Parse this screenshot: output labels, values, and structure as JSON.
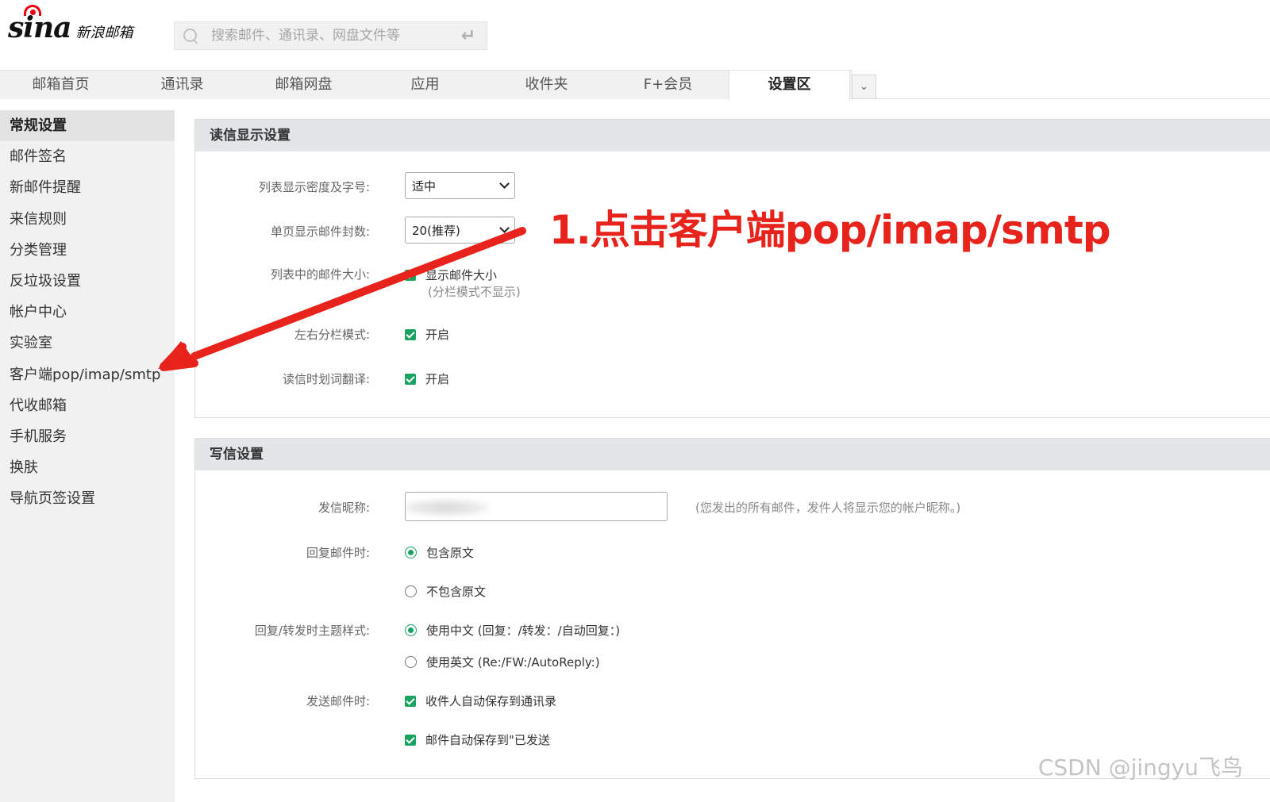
{
  "header": {
    "logo_mark": "sina",
    "logo_text": "新浪邮箱",
    "search_placeholder": "搜索邮件、通讯录、网盘文件等",
    "enter_glyph": "↵"
  },
  "nav": {
    "items": [
      "邮箱首页",
      "通讯录",
      "邮箱网盘",
      "应用",
      "收件夹",
      "F+会员",
      "设置区"
    ],
    "active_index": 6,
    "more_glyph": "⌄"
  },
  "sidebar": {
    "items": [
      "常规设置",
      "邮件签名",
      "新邮件提醒",
      "来信规则",
      "分类管理",
      "反垃圾设置",
      "帐户中心",
      "实验室",
      "客户端pop/imap/smtp",
      "代收邮箱",
      "手机服务",
      "换肤",
      "导航页签设置"
    ],
    "active_index": 0
  },
  "read_panel": {
    "title": "读信显示设置",
    "density_label": "列表显示密度及字号:",
    "density_value": "适中",
    "per_page_label": "单页显示邮件封数:",
    "per_page_value": "20(推荐)",
    "size_label": "列表中的邮件大小:",
    "size_option": "显示邮件大小",
    "size_note": "(分栏模式不显示)",
    "split_label": "左右分栏模式:",
    "split_option": "开启",
    "translate_label": "读信时划词翻译:",
    "translate_option": "开启"
  },
  "write_panel": {
    "title": "写信设置",
    "nick_label": "发信昵称:",
    "nick_hint": "(您发出的所有邮件，发件人将显示您的帐户昵称。)",
    "reply_label": "回复邮件时:",
    "reply_opt1": "包含原文",
    "reply_opt2": "不包含原文",
    "subject_label": "回复/转发时主题样式:",
    "subject_opt1": "使用中文 (回复：/转发：/自动回复：)",
    "subject_opt2": "使用英文 (Re:/FW:/AutoReply:)",
    "send_label": "发送邮件时:",
    "send_opt1": "收件人自动保存到通讯录",
    "send_opt2": "邮件自动保存到\"已发送"
  },
  "annotation": {
    "text": "1.点击客户端pop/imap/smtp",
    "color": "#e8231b"
  },
  "watermark": "CSDN @jingyu飞鸟",
  "colors": {
    "accent_green": "#1aa260",
    "annotation_red": "#e8231b",
    "brand_red": "#e60012"
  }
}
